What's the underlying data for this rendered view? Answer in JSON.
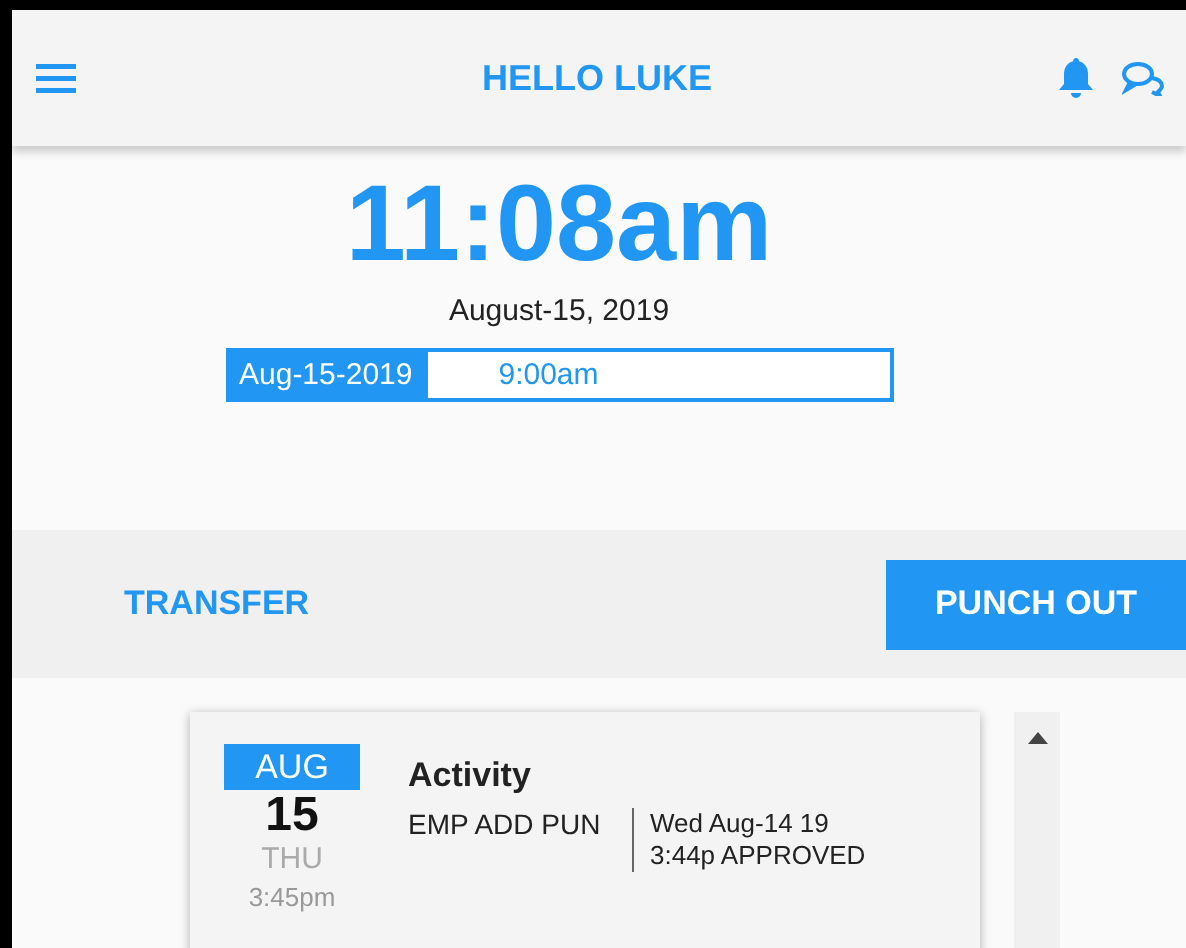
{
  "header": {
    "title": "HELLO LUKE"
  },
  "clock": {
    "time": "11:08am",
    "date": "August-15, 2019"
  },
  "shift": {
    "date": "Aug-15-2019",
    "time": "9:00am"
  },
  "actions": {
    "transfer": "TRANSFER",
    "punch": "PUNCH OUT"
  },
  "entries": [
    {
      "month": "AUG",
      "day": "15",
      "weekday": "THU",
      "time": "3:45pm",
      "title": "Activity",
      "code": "EMP ADD PUN",
      "detail_1": "Wed Aug-14 19",
      "detail_2": "3:44p APPROVED"
    }
  ]
}
